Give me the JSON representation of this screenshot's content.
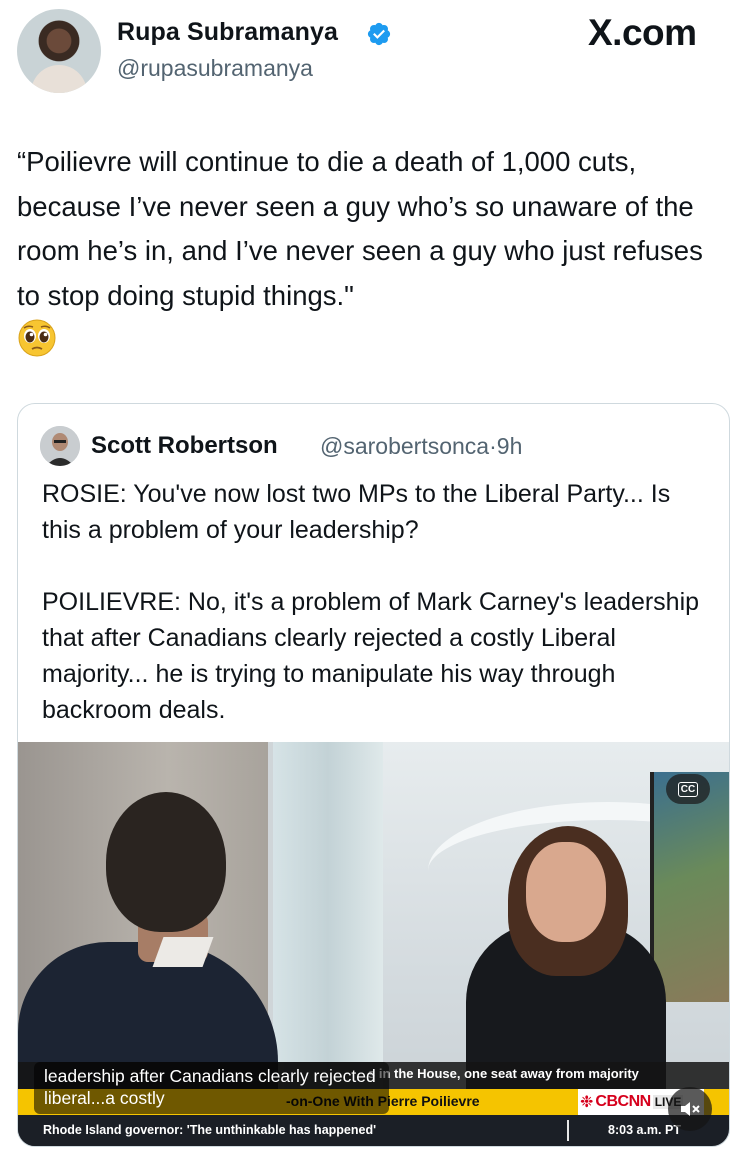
{
  "header": {
    "author_name": "Rupa Subramanya",
    "author_handle": "@rupasubramanya",
    "site_logo": "X.com",
    "verified_icon": "verified-badge-icon"
  },
  "tweet": {
    "text": "“Poilievre will continue to die a death of 1,000 cuts, because I’ve never seen a guy who’s so unaware of the room he’s in, and I’ve never seen a guy who just refuses to stop doing stupid things.\"",
    "emoji": "pleading-face-emoji"
  },
  "quote": {
    "author_name": "Scott Robertson",
    "author_handle": "@sarobertsonca",
    "separator": "·",
    "time": "9h",
    "paragraph_1": "ROSIE: You've now lost two MPs to the Liberal Party... Is this a problem of your leadership?",
    "paragraph_2": "POILIEVRE: No, it's a problem of Mark Carney's leadership that after Canadians clearly rejected a costly Liberal majority... he is trying to manipulate his way through backroom deals."
  },
  "video": {
    "cc_label": "CC",
    "caption": "leadership after Canadians clearly rejected liberal...a costly",
    "ticker_top": "s in the House, one seat away from majority",
    "ticker_yellow": "-on-One With Pierre Poilievre",
    "network_logo": "CBCNN",
    "live_badge": "LIVE",
    "ticker_bottom": "Rhode Island governor: 'The unthinkable has happened'",
    "time": "8:03 a.m. PT",
    "mute_icon": "speaker-muted-icon"
  }
}
